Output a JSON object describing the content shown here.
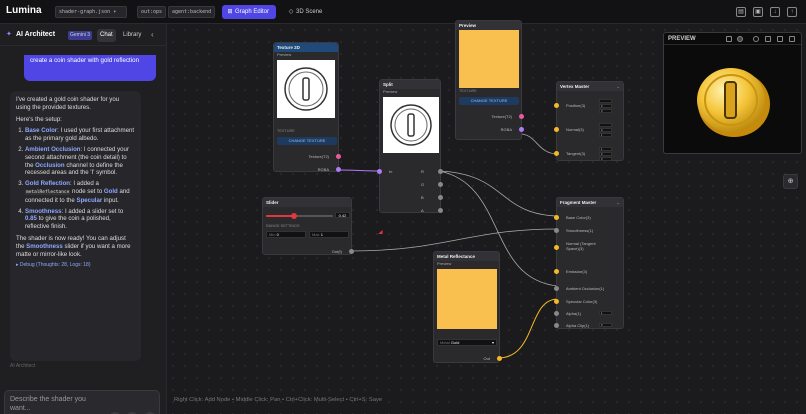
{
  "app": {
    "title": "Lumina"
  },
  "topbar": {
    "file_chip": "shader-graph.json",
    "ops_chip": "out:ops",
    "agent_chip": "agent:backend",
    "tabs": [
      {
        "label": "Graph Editor",
        "active": true
      },
      {
        "label": "3D Scene",
        "active": false
      }
    ],
    "icons": [
      "document-icon",
      "save-icon",
      "download-icon",
      "upload-icon"
    ]
  },
  "sidebar": {
    "title": "AI Architect",
    "model_badge": "Gemini 3",
    "tabs": [
      "Chat",
      "Library"
    ],
    "user_message": "create a coin shader with gold reflection",
    "assistant": {
      "intro": "I've created a gold coin shader for you using the provided textures.",
      "setup": "Here's the setup:",
      "steps": [
        {
          "title": "Base Color",
          "text": ": I used your first attachment as the primary gold albedo."
        },
        {
          "title": "Ambient Occlusion",
          "text_a": ": I connected your second attachment (the coin detail) to the ",
          "hl": "Occlusion",
          "text_b": " channel to define the recessed areas and the 'I' symbol."
        },
        {
          "title": "Gold Reflection",
          "text_a": ": I added a ",
          "code": "metalReflectance",
          "text_b": " node set to ",
          "hl": "Gold",
          "text_c": " and connected it to the ",
          "hl2": "Specular",
          "text_d": " input."
        },
        {
          "title": "Smoothness",
          "text_a": ": I added a slider set to ",
          "hl": "0.85",
          "text_b": " to give the coin a polished, reflective finish."
        }
      ],
      "outro_a": "The shader is now ready! You can adjust the ",
      "outro_hl": "Smoothness",
      "outro_b": " slider if you want a more matte or mirror-like look.",
      "debug": "▸ Debug (Thoughts: 28, Logs: 18)"
    },
    "ai_name": "AI Architect",
    "input_placeholder": "Describe the shader you want..."
  },
  "canvas": {
    "hint": "Right Click: Add Node • Middle Click: Pan • Ctrl+Click: Multi-Select • Ctrl+S: Save",
    "nodes": {
      "texture2d": {
        "title": "Texture 2D",
        "preview": "Preview",
        "section": "TEXTURE",
        "button": "CHANGE TEXTURE",
        "out1": "Texture(T2)",
        "out2": "RGBA"
      },
      "texture_b": {
        "title": "Preview",
        "section": "TEXTURE",
        "button": "CHANGE TEXTURE",
        "out1": "Texture(T2)",
        "out2": "RGBA"
      },
      "split": {
        "title": "Split",
        "preview": "Preview",
        "in": "In",
        "outs": [
          "R",
          "G",
          "B",
          "A"
        ]
      },
      "slider": {
        "title": "Slider",
        "value": "0.42",
        "range_label": "RANGE SETTINGS",
        "min_label": "Min",
        "min": "0",
        "max_label": "Max",
        "max": "1",
        "out": "Out(f)"
      },
      "metal": {
        "title": "Metal Reflectance",
        "preview": "Preview",
        "metal_label": "Metal",
        "metal_value": "Gold",
        "out": "Out"
      },
      "vertex": {
        "title": "Vertex Master",
        "inputs": [
          "Position(3)",
          "Normal(3)",
          "Tangent(3)"
        ],
        "defaults": [
          "0",
          "0",
          "0",
          "1",
          "0",
          "0"
        ]
      },
      "fragment": {
        "title": "Fragment Master",
        "inputs": [
          "Base Color(3)",
          "Smoothness(1)",
          "Normal (Tangent Space)(3)",
          "Emission(3)",
          "Ambient Occlusion(1)",
          "Specular Color(3)",
          "Alpha(1)",
          "Alpha Clip(1)"
        ],
        "alpha_val": "1",
        "clip_val": "0"
      }
    },
    "preview_panel": {
      "title": "PREVIEW"
    }
  },
  "colors": {
    "accent": "#4f46e5",
    "gold": "#f9bf4f",
    "pink": "#ec5a9c",
    "purple": "#b07cf5",
    "yellow": "#f5b827"
  }
}
